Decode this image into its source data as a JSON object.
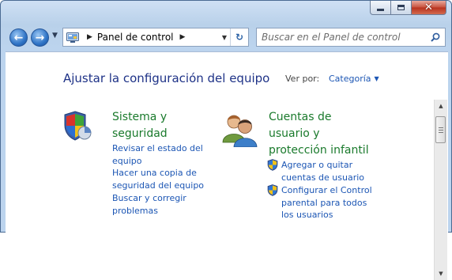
{
  "window": {
    "minimize_symbol": "",
    "close_symbol": "✕"
  },
  "nav": {
    "back_symbol": "←",
    "forward_symbol": "→"
  },
  "address": {
    "location": "Panel de control",
    "chevron": "▶",
    "refresh_symbol": "↻"
  },
  "search": {
    "placeholder": "Buscar en el Panel de control"
  },
  "main": {
    "title": "Ajustar la configuración del equipo",
    "view_by_label": "Ver por:",
    "view_by_value": "Categoría",
    "categories": [
      {
        "title_lines": [
          "Sistema y",
          "seguridad"
        ],
        "links": [
          {
            "lines": [
              "Revisar el estado del",
              "equipo"
            ],
            "shield": false
          },
          {
            "lines": [
              "Hacer una copia de",
              "seguridad del equipo"
            ],
            "shield": false
          },
          {
            "lines": [
              "Buscar y corregir",
              "problemas"
            ],
            "shield": false
          }
        ]
      },
      {
        "title_lines": [
          "Cuentas de",
          "usuario y",
          "protección infantil"
        ],
        "links": [
          {
            "lines": [
              "Agregar o quitar",
              "cuentas de usuario"
            ],
            "shield": true
          },
          {
            "lines": [
              "Configurar el Control",
              "parental para todos",
              "los usuarios"
            ],
            "shield": true
          }
        ]
      }
    ]
  },
  "colors": {
    "title_blue": "#1e3287",
    "link_blue": "#1c56b4",
    "category_green": "#1a7a2c"
  }
}
